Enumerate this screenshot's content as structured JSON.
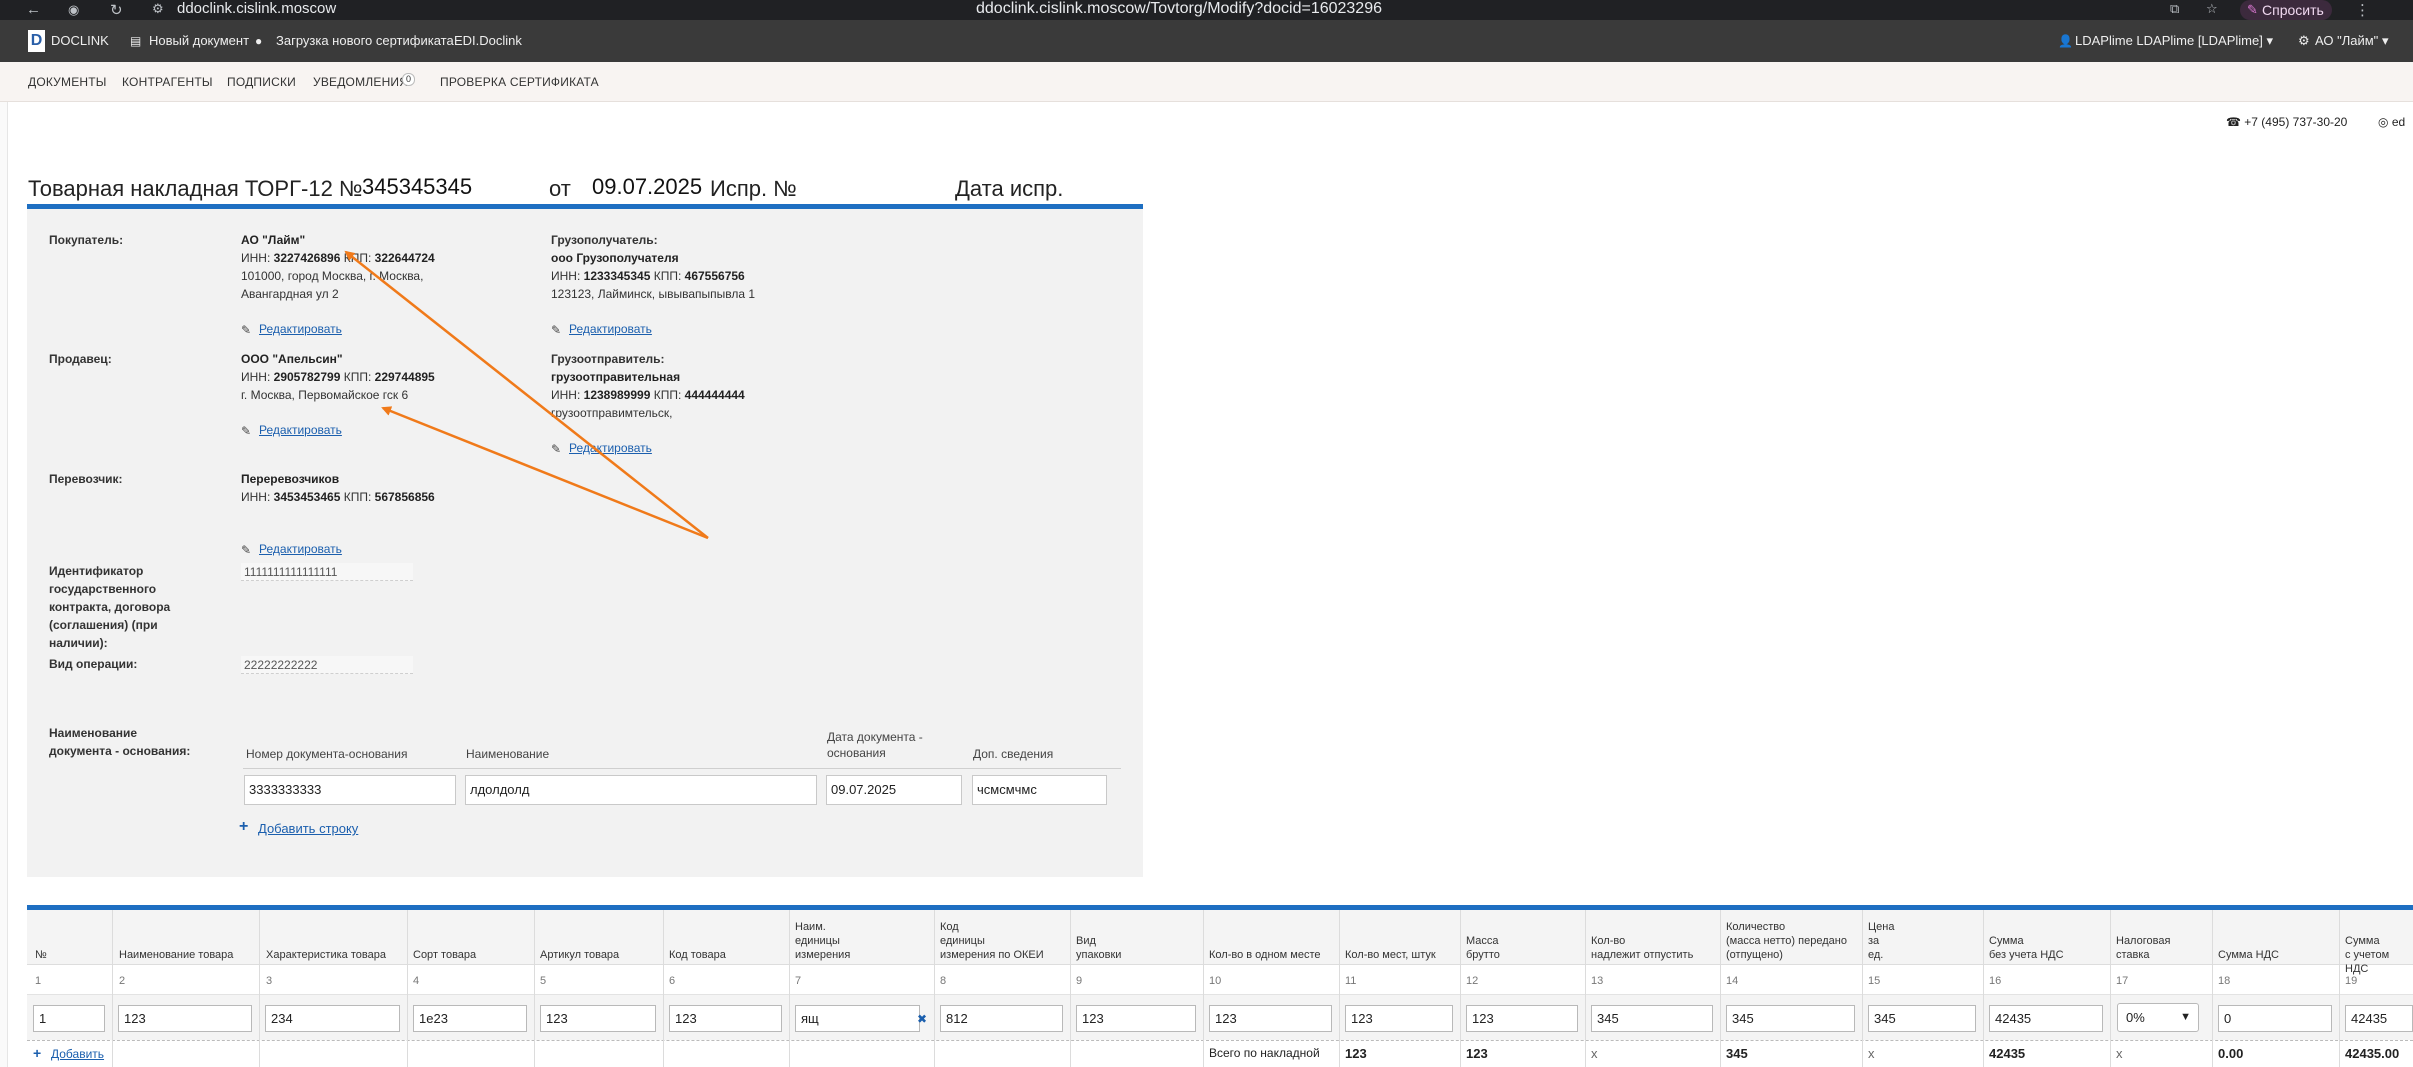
{
  "browser": {
    "url": "ddoclink.cislink.moscow",
    "center_url": "ddoclink.cislink.moscow/Tovtorg/Modify?docid=16023296",
    "ask_label": "Спросить"
  },
  "topbar": {
    "logo_letter": "D",
    "brand": "DOCLINK",
    "new_doc": "Новый документ",
    "cert_upload": "Загрузка нового сертификата",
    "edi": "EDI.Doclink",
    "user": "LDAPlime LDAPlime [LDAPlime]",
    "org": "АО \"Лайм\""
  },
  "subnav": {
    "items": [
      "ДОКУМЕНТЫ",
      "КОНТРАГЕНТЫ",
      "ПОДПИСКИ",
      "УВЕДОМЛЕНИЯ",
      "ПРОВЕРКА СЕРТИФИКАТА"
    ],
    "notif_count": "0"
  },
  "contact": {
    "phone": "+7 (495) 737-30-20",
    "ed": "ed"
  },
  "doc": {
    "title": "Товарная накладная ТОРГ-12 №",
    "number": "345345345",
    "from_label": "от",
    "date": "09.07.2025",
    "corr_label": "Испр. №",
    "corr_date_label": "Дата испр."
  },
  "parties": {
    "buyer": {
      "label": "Покупатель:",
      "name": "АО \"Лайм\"",
      "inn_label": "ИНН:",
      "inn": "3227426896",
      "kpp_label": "КПП:",
      "kpp": "322644724",
      "addr1": "101000, город Москва, г. Москва,",
      "addr2": "Авангардная ул 2"
    },
    "consignee": {
      "label": "Грузополучатель:",
      "name": "ооо Грузополучателя",
      "inn_label": "ИНН:",
      "inn": "1233345345",
      "kpp_label": "КПП:",
      "kpp": "467556756",
      "addr1": "123123, Лайминск, ывывапыпывла 1"
    },
    "seller": {
      "label": "Продавец:",
      "name": "ООО \"Апельсин\"",
      "inn_label": "ИНН:",
      "inn": "2905782799",
      "kpp_label": "КПП:",
      "kpp": "229744895",
      "addr1": "г. Москва, Первомайское гск 6"
    },
    "shipper": {
      "label": "Грузоотправитель:",
      "name": "грузоотправительная",
      "inn_label": "ИНН:",
      "inn": "1238989999",
      "kpp_label": "КПП:",
      "kpp": "444444444",
      "addr1": "грузоотправимтельск,"
    },
    "carrier": {
      "label": "Перевозчик:",
      "name": "Переревозчиков",
      "inn_label": "ИНН:",
      "inn": "3453453465",
      "kpp_label": "КПП:",
      "kpp": "567856856"
    },
    "edit_label": "Редактировать"
  },
  "contract": {
    "label_lines": [
      "Идентификатор",
      "государственного",
      "контракта, договора",
      "(соглашения) (при",
      "наличии):"
    ],
    "value": "1111111111111111"
  },
  "operation": {
    "label": "Вид операции:",
    "value": "22222222222"
  },
  "basis": {
    "label_lines": [
      "Наименование",
      "документа - основания:"
    ],
    "headers": [
      "Номер документа-основания",
      "Наименование",
      "Дата документа -",
      "основания",
      "Доп. сведения"
    ],
    "number": "3333333333",
    "name": "лдолдолд",
    "date": "09.07.2025",
    "extra": "чсмсмчмс",
    "add_row": "Добавить строку"
  },
  "goods": {
    "headers": [
      [
        "№"
      ],
      [
        "Наименование товара"
      ],
      [
        "Характеристика товара"
      ],
      [
        "Сорт товара"
      ],
      [
        "Артикул товара"
      ],
      [
        "Код товара"
      ],
      [
        "Наим.",
        "единицы",
        "измерения"
      ],
      [
        "Код",
        "единицы",
        "измерения по ОКЕИ"
      ],
      [
        "Вид",
        "упаковки"
      ],
      [
        "Кол-во в одном месте"
      ],
      [
        "Кол-во мест, штук"
      ],
      [
        "Масса",
        "брутто"
      ],
      [
        "Кол-во",
        "надлежит отпустить"
      ],
      [
        "Количество",
        "(масса нетто) передано",
        "(отпущено)"
      ],
      [
        "Цена",
        "за",
        "ед."
      ],
      [
        "Сумма",
        "без учета НДС"
      ],
      [
        "Налоговая",
        "ставка"
      ],
      [
        "Сумма НДС"
      ],
      [
        "Сумма",
        "с учетом НДС"
      ]
    ],
    "col_numbers": [
      "1",
      "2",
      "3",
      "4",
      "5",
      "6",
      "7",
      "8",
      "9",
      "10",
      "11",
      "12",
      "13",
      "14",
      "15",
      "16",
      "17",
      "18",
      "19"
    ],
    "row": {
      "num": "1",
      "name": "123",
      "char": "234",
      "sort": "1e23",
      "article": "123",
      "code": "123",
      "unit": "ящ",
      "okei": "812",
      "pack": "123",
      "per_place": "123",
      "places": "123",
      "gross": "123",
      "to_release": "345",
      "net": "345",
      "price": "345",
      "sum_no_vat": "42435",
      "vat_rate": "0%",
      "vat_sum": "0",
      "sum_vat": "42435"
    },
    "add_label": "Добавить",
    "totals": {
      "label": "Всего по накладной",
      "places": "123",
      "gross": "123",
      "to_release": "x",
      "net": "345",
      "price": "x",
      "sum_no_vat": "42435",
      "vat_rate": "x",
      "vat_sum": "0.00",
      "sum_vat": "42435.00"
    }
  },
  "colors": {
    "accent": "#1e6fc2",
    "arrow": "#f07a1a",
    "topbar": "#3a3a3a"
  }
}
